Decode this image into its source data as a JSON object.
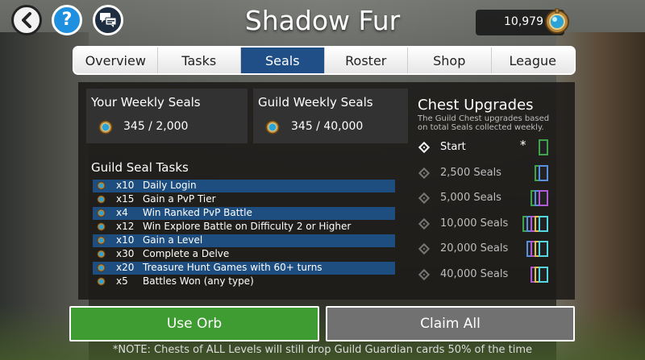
{
  "header": {
    "title": "Shadow Fur",
    "gold": "10,979"
  },
  "tabs": [
    "Overview",
    "Tasks",
    "Seals",
    "Roster",
    "Shop",
    "League"
  ],
  "active_tab": "Seals",
  "weekly": {
    "your_label": "Your Weekly Seals",
    "your_value": "345 / 2,000",
    "guild_label": "Guild Weekly Seals",
    "guild_value": "345 / 40,000"
  },
  "tasks": {
    "title": "Guild Seal Tasks",
    "items": [
      {
        "count": "x10",
        "name": "Daily Login",
        "highlighted": true
      },
      {
        "count": "x15",
        "name": "Gain a PvP Tier",
        "highlighted": false
      },
      {
        "count": "x4",
        "name": "Win Ranked PvP Battle",
        "highlighted": true
      },
      {
        "count": "x12",
        "name": "Win Explore Battle on Difficulty 2 or Higher",
        "highlighted": false
      },
      {
        "count": "x10",
        "name": "Gain a Level",
        "highlighted": true
      },
      {
        "count": "x30",
        "name": "Complete a Delve",
        "highlighted": false
      },
      {
        "count": "x20",
        "name": "Treasure Hunt Games with 60+ turns",
        "highlighted": true
      },
      {
        "count": "x5",
        "name": "Battles Won (any type)",
        "highlighted": false
      }
    ]
  },
  "chest_upgrades": {
    "title": "Chest Upgrades",
    "desc_line1": "The Guild Chest upgrades based",
    "desc_line2": "on total Seals collected weekly.",
    "current_marker": "*",
    "tiers": [
      {
        "label": "Start",
        "active": true,
        "cards": [
          "#3fa34d"
        ]
      },
      {
        "label": "2,500 Seals",
        "active": false,
        "cards": [
          "#3fa34d",
          "#5a8fe0"
        ]
      },
      {
        "label": "5,000 Seals",
        "active": false,
        "cards": [
          "#3fa34d",
          "#5a8fe0",
          "#b05ad8"
        ]
      },
      {
        "label": "10,000 Seals",
        "active": false,
        "cards": [
          "#3fa34d",
          "#5a8fe0",
          "#b05ad8",
          "#e3c04a",
          "#55d6e0"
        ]
      },
      {
        "label": "20,000 Seals",
        "active": false,
        "cards": [
          "#5a8fe0",
          "#b05ad8",
          "#e3c04a",
          "#55d6e0"
        ]
      },
      {
        "label": "40,000 Seals",
        "active": false,
        "cards": [
          "#b05ad8",
          "#e3c04a",
          "#55d6e0"
        ]
      }
    ]
  },
  "buttons": {
    "use_orb": "Use Orb",
    "claim_all": "Claim All"
  },
  "note": "*NOTE: Chests of ALL Levels will still drop Guild Guardian cards 50% of the time",
  "colors": {
    "accent_tab": "#1f4f86",
    "orb_button": "#3f9c32",
    "claim_button": "#717171",
    "task_highlight": "#1d4e7f"
  }
}
